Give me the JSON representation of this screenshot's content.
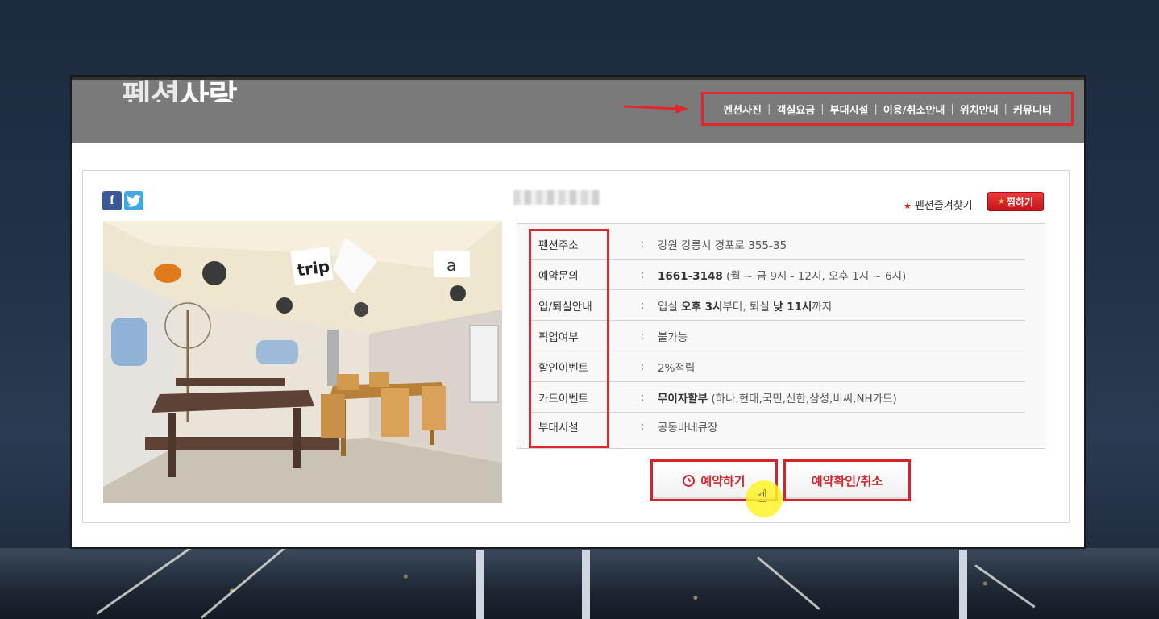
{
  "header": {
    "logo_text_a": "펜션",
    "logo_text_b": "사랑",
    "nav": [
      {
        "label": "펜션사진"
      },
      {
        "label": "객실요금"
      },
      {
        "label": "부대시설"
      },
      {
        "label": "이용/취소안내"
      },
      {
        "label": "위치안내"
      },
      {
        "label": "커뮤니티"
      }
    ],
    "nav_separator": "|",
    "highlight_color": "#e3262b"
  },
  "social": {
    "facebook_icon": "facebook-icon",
    "twitter_icon": "twitter-icon",
    "facebook_glyph": "f",
    "twitter_glyph": "t"
  },
  "favorite": {
    "text": "펜션즐겨찾기",
    "button_label": "찜하기"
  },
  "info": {
    "colon": ":",
    "rows": [
      {
        "label": "펜션주소",
        "value": "강원 강릉시 경포로 355-35"
      },
      {
        "label": "예약문의",
        "value_bold": "1661-3148",
        "value": " (월 ~ 금 9시 - 12시, 오후 1시 ~ 6시)"
      },
      {
        "label": "입/퇴실안내",
        "v1": "입실 ",
        "v2": "오후 3시",
        "v3": "부터, 퇴실 ",
        "v4": "낮 11시",
        "v5": "까지"
      },
      {
        "label": "픽업여부",
        "value": "불가능"
      },
      {
        "label": "할인이벤트",
        "value": "2%적립"
      },
      {
        "label": "카드이벤트",
        "value_bold": "무이자할부",
        "value": " (하나,현대,국민,신한,삼성,비씨,NH카드)"
      },
      {
        "label": "부대시설",
        "value": "공동바베큐장"
      }
    ]
  },
  "buttons": {
    "reserve": "예약하기",
    "confirm": "예약확인/취소"
  },
  "photo": {
    "sign_trip": "trip",
    "sign_a": "a"
  }
}
